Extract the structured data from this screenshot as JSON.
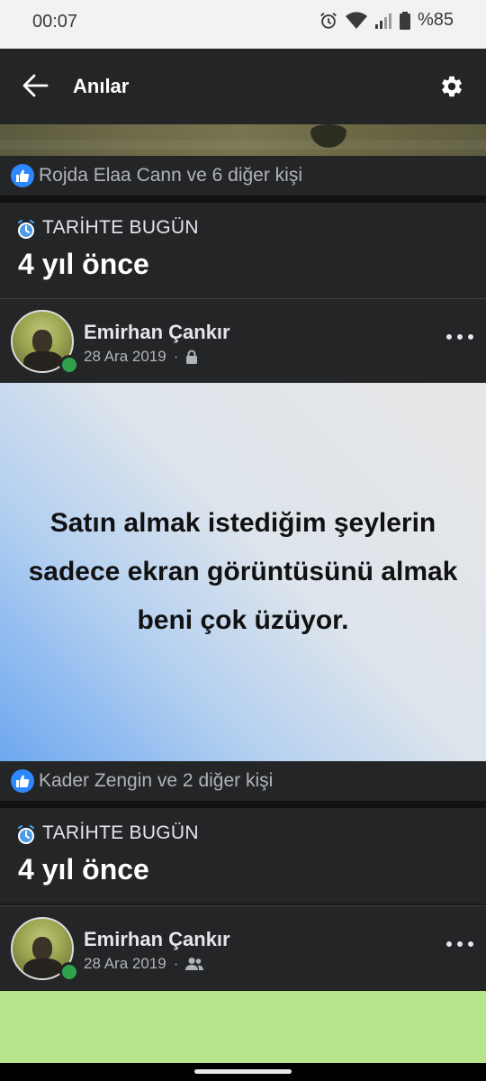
{
  "status_bar": {
    "time": "00:07",
    "battery": "%85",
    "icons": [
      "alarm-icon",
      "wifi-icon",
      "signal-icon",
      "battery-icon"
    ]
  },
  "app_bar": {
    "title": "Anılar",
    "back_icon": "arrow-left-icon",
    "settings_icon": "gear-icon"
  },
  "feed": {
    "top_reactions": "Rojda Elaa Cann ve 6 diğer kişi",
    "memory_1": {
      "label": "TARİHTE BUGÜN",
      "ago": "4 yıl önce",
      "author": "Emirhan Çankır",
      "date": "28 Ara 2019",
      "separator": "·",
      "privacy_icon": "lock-icon",
      "post_text": "Satın almak istediğim şeylerin sadece ekran görüntüsünü almak beni çok üzüyor.",
      "reactions": "Kader Zengin ve 2 diğer kişi"
    },
    "memory_2": {
      "label": "TARİHTE BUGÜN",
      "ago": "4 yıl önce",
      "author": "Emirhan Çankır",
      "date": "28 Ara 2019",
      "separator": "·",
      "privacy_icon": "friends-icon"
    }
  },
  "colors": {
    "app_bg": "#18191a",
    "card_bg": "#242526",
    "accent_blue": "#2d88ff",
    "online_green": "#31a24c",
    "status_bar_bg": "#f2f2f2"
  }
}
